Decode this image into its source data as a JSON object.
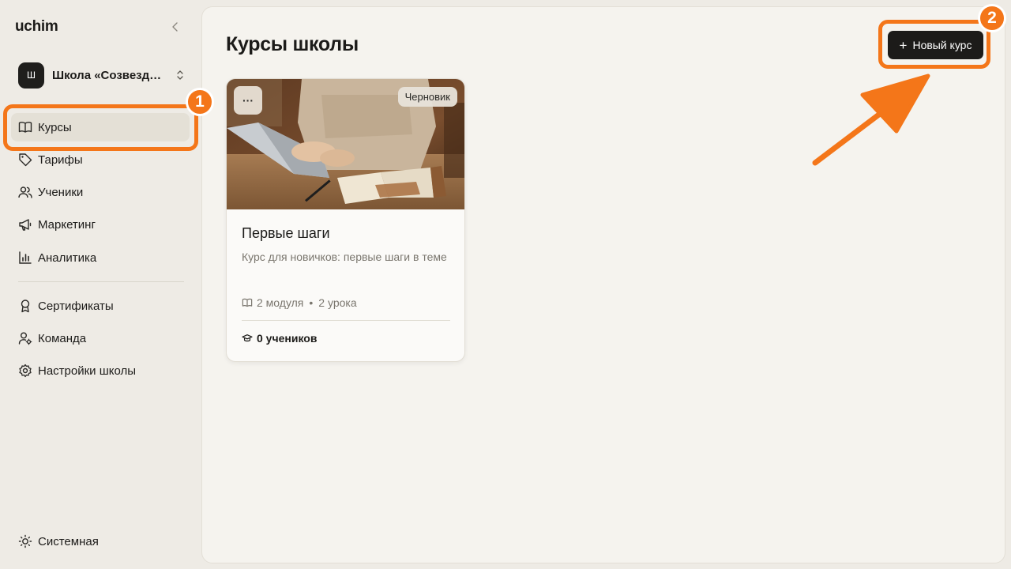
{
  "app": {
    "logo": "uchim"
  },
  "school": {
    "avatar_letter": "Ш",
    "name": "Школа «Созвезд…"
  },
  "sidebar": {
    "items": [
      {
        "label": "Курсы",
        "icon": "book-open-icon",
        "active": true
      },
      {
        "label": "Тарифы",
        "icon": "tag-icon"
      },
      {
        "label": "Ученики",
        "icon": "users-icon"
      },
      {
        "label": "Маркетинг",
        "icon": "megaphone-icon"
      },
      {
        "label": "Аналитика",
        "icon": "bar-chart-icon"
      },
      {
        "label": "Сертификаты",
        "icon": "award-icon"
      },
      {
        "label": "Команда",
        "icon": "user-settings-icon"
      },
      {
        "label": "Настройки школы",
        "icon": "gear-icon"
      }
    ],
    "theme_label": "Системная"
  },
  "main": {
    "title": "Курсы школы",
    "new_course_label": "Новый курс",
    "new_course_icon": "plus-icon"
  },
  "course": {
    "status": "Черновик",
    "more_label": "···",
    "title": "Первые шаги",
    "description": "Курс для новичков: первые шаги в теме",
    "modules": "2 модуля",
    "separator": "•",
    "lessons": "2 урока",
    "students": "0 учеников"
  },
  "annotations": {
    "step1": "1",
    "step2": "2",
    "color": "#f47619"
  }
}
